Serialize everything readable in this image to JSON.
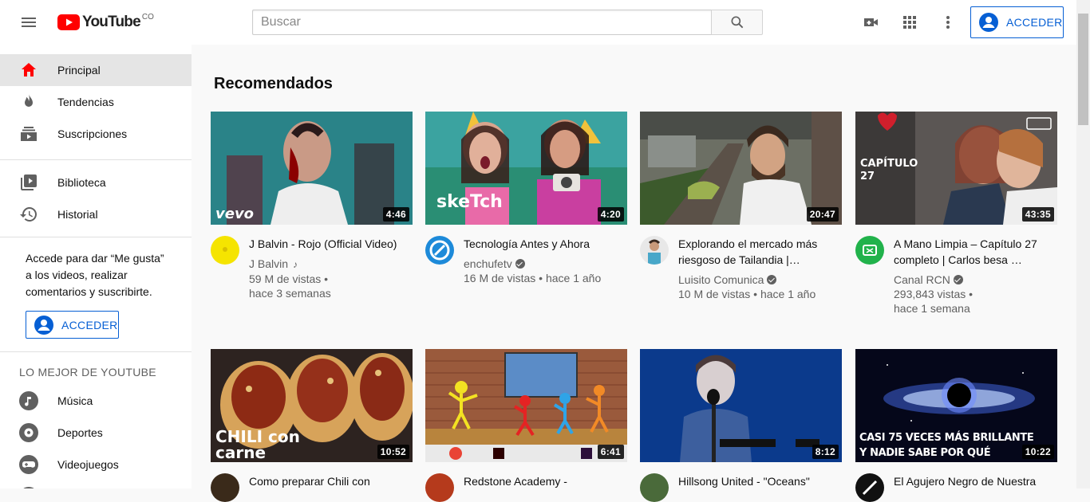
{
  "header": {
    "logo_text": "YouTube",
    "region": "CO",
    "search_placeholder": "Buscar",
    "signin_label": "ACCEDER"
  },
  "sidebar": {
    "primary": [
      {
        "label": "Principal",
        "icon": "home-icon",
        "active": true
      },
      {
        "label": "Tendencias",
        "icon": "fire-icon"
      },
      {
        "label": "Suscripciones",
        "icon": "subscriptions-icon"
      }
    ],
    "library": [
      {
        "label": "Biblioteca",
        "icon": "library-icon"
      },
      {
        "label": "Historial",
        "icon": "history-icon"
      }
    ],
    "signin_message": "Accede para dar “Me gusta” a los videos, realizar comentarios y suscribirte.",
    "signin_label": "ACCEDER",
    "best_heading": "LO MEJOR DE YOUTUBE",
    "best": [
      {
        "label": "Música",
        "icon": "music-icon"
      },
      {
        "label": "Deportes",
        "icon": "sports-icon"
      },
      {
        "label": "Videojuegos",
        "icon": "gaming-icon"
      }
    ]
  },
  "main": {
    "section_title": "Recomendados",
    "videos": [
      {
        "title": "J Balvin - Rojo (Official Video)",
        "channel": "J Balvin",
        "views": "59 M de vistas •",
        "age": "hace 3 semanas",
        "duration": "4:46",
        "thumb_label": "vevo"
      },
      {
        "title": "Tecnología Antes y Ahora",
        "channel": "enchufetv",
        "views": "16 M de vistas • hace 1 año",
        "age": "",
        "duration": "4:20",
        "thumb_label": "skeTch"
      },
      {
        "title": "Explorando el mercado más riesgoso de Tailandia |…",
        "channel": "Luisito Comunica",
        "views": "10 M de vistas • hace 1 año",
        "age": "",
        "duration": "20:47",
        "thumb_label": ""
      },
      {
        "title": "A Mano Limpia – Capítulo 27 completo | Carlos besa …",
        "channel": "Canal RCN",
        "views": "293,843 vistas •",
        "age": "hace 1 semana",
        "duration": "43:35",
        "thumb_label": "CAPÍTULO 27"
      },
      {
        "title": "Como preparar Chili con",
        "channel": "",
        "views": "",
        "age": "",
        "duration": "10:52",
        "thumb_label": "CHILI con carne"
      },
      {
        "title": "Redstone Academy -",
        "channel": "",
        "views": "",
        "age": "",
        "duration": "6:41",
        "thumb_label": ""
      },
      {
        "title": "Hillsong United - \"Oceans\"",
        "channel": "",
        "views": "",
        "age": "",
        "duration": "8:12",
        "thumb_label": ""
      },
      {
        "title": "El Agujero Negro de Nuestra",
        "channel": "",
        "views": "",
        "age": "",
        "duration": "10:22",
        "thumb_label": "CASI 75 VECES MÁS BRILLANTE Y NADIE SABE POR QUÉ"
      }
    ]
  }
}
